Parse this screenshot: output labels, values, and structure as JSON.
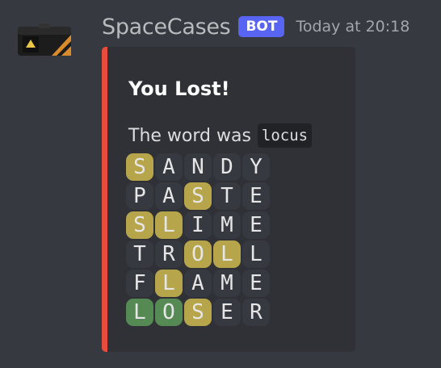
{
  "message": {
    "username": "SpaceCases",
    "badge": "BOT",
    "timestamp": "Today at 20:18",
    "avatar_icon": "weapon-case-icon"
  },
  "embed": {
    "accent_color": "#e74c3c",
    "title": "You Lost!",
    "description_prefix": "The word was",
    "answer": "locus",
    "grid": [
      [
        {
          "letter": "S",
          "state": "present"
        },
        {
          "letter": "A",
          "state": "absent"
        },
        {
          "letter": "N",
          "state": "absent"
        },
        {
          "letter": "D",
          "state": "absent"
        },
        {
          "letter": "Y",
          "state": "absent"
        }
      ],
      [
        {
          "letter": "P",
          "state": "absent"
        },
        {
          "letter": "A",
          "state": "absent"
        },
        {
          "letter": "S",
          "state": "present"
        },
        {
          "letter": "T",
          "state": "absent"
        },
        {
          "letter": "E",
          "state": "absent"
        }
      ],
      [
        {
          "letter": "S",
          "state": "present"
        },
        {
          "letter": "L",
          "state": "present"
        },
        {
          "letter": "I",
          "state": "absent"
        },
        {
          "letter": "M",
          "state": "absent"
        },
        {
          "letter": "E",
          "state": "absent"
        }
      ],
      [
        {
          "letter": "T",
          "state": "absent"
        },
        {
          "letter": "R",
          "state": "absent"
        },
        {
          "letter": "O",
          "state": "present"
        },
        {
          "letter": "L",
          "state": "present"
        },
        {
          "letter": "L",
          "state": "absent"
        }
      ],
      [
        {
          "letter": "F",
          "state": "absent"
        },
        {
          "letter": "L",
          "state": "present"
        },
        {
          "letter": "A",
          "state": "absent"
        },
        {
          "letter": "M",
          "state": "absent"
        },
        {
          "letter": "E",
          "state": "absent"
        }
      ],
      [
        {
          "letter": "L",
          "state": "correct"
        },
        {
          "letter": "O",
          "state": "correct"
        },
        {
          "letter": "S",
          "state": "present"
        },
        {
          "letter": "E",
          "state": "absent"
        },
        {
          "letter": "R",
          "state": "absent"
        }
      ]
    ]
  },
  "colors": {
    "absent": "#36393f",
    "present": "#b6a54b",
    "correct": "#568a55",
    "bot_badge": "#5865f2"
  }
}
